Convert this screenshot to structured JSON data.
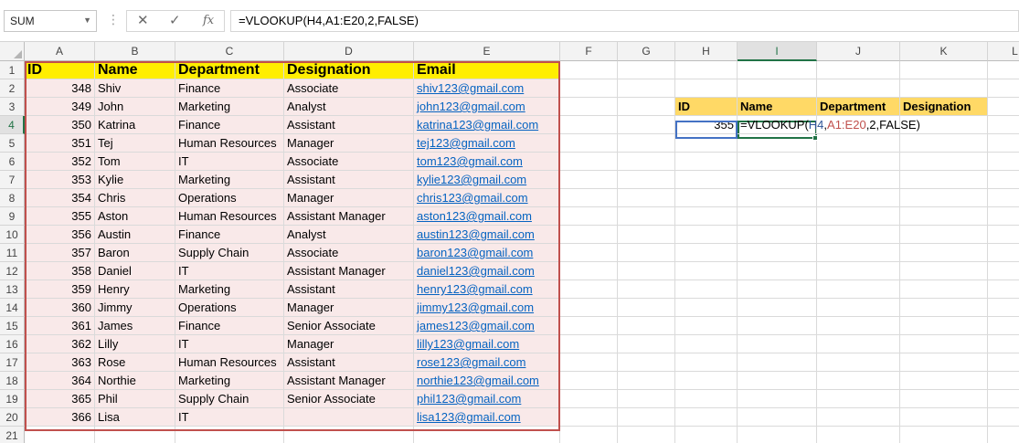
{
  "formula_bar": {
    "name_box": "SUM",
    "cancel_icon": "✕",
    "enter_icon": "✓",
    "fx_label": "fx",
    "formula": "=VLOOKUP(H4,A1:E20,2,FALSE)"
  },
  "columns": [
    "A",
    "B",
    "C",
    "D",
    "E",
    "F",
    "G",
    "H",
    "I",
    "J",
    "K",
    "L"
  ],
  "rows": [
    "1",
    "2",
    "3",
    "4",
    "5",
    "6",
    "7",
    "8",
    "9",
    "10",
    "11",
    "12",
    "13",
    "14",
    "15",
    "16",
    "17",
    "18",
    "19",
    "20",
    "21"
  ],
  "table": {
    "headers": [
      "ID",
      "Name",
      "Department",
      "Designation",
      "Email"
    ],
    "records": [
      [
        "348",
        "Shiv",
        "Finance",
        "Associate",
        "shiv123@gmail.com"
      ],
      [
        "349",
        "John",
        "Marketing",
        "Analyst",
        "john123@gmail.com"
      ],
      [
        "350",
        "Katrina",
        "Finance",
        "Assistant",
        "katrina123@gmail.com"
      ],
      [
        "351",
        "Tej",
        "Human Resources",
        "Manager",
        "tej123@gmail.com"
      ],
      [
        "352",
        "Tom",
        "IT",
        "Associate",
        "tom123@gmail.com"
      ],
      [
        "353",
        "Kylie",
        "Marketing",
        "Assistant",
        "kylie123@gmail.com"
      ],
      [
        "354",
        "Chris",
        "Operations",
        "Manager",
        "chris123@gmail.com"
      ],
      [
        "355",
        "Aston",
        "Human Resources",
        "Assistant Manager",
        "aston123@gmail.com"
      ],
      [
        "356",
        "Austin",
        "Finance",
        "Analyst",
        "austin123@gmail.com"
      ],
      [
        "357",
        "Baron",
        "Supply Chain",
        "Associate",
        "baron123@gmail.com"
      ],
      [
        "358",
        "Daniel",
        "IT",
        "Assistant Manager",
        "daniel123@gmail.com"
      ],
      [
        "359",
        "Henry",
        "Marketing",
        "Assistant",
        "henry123@gmail.com"
      ],
      [
        "360",
        "Jimmy",
        "Operations",
        "Manager",
        "jimmy123@gmail.com"
      ],
      [
        "361",
        "James",
        "Finance",
        "Senior Associate",
        "james123@gmail.com"
      ],
      [
        "362",
        "Lilly",
        "IT",
        "Manager",
        "lilly123@gmail.com"
      ],
      [
        "363",
        "Rose",
        "Human Resources",
        "Assistant",
        "rose123@gmail.com"
      ],
      [
        "364",
        "Northie",
        "Marketing",
        "Assistant Manager",
        "northie123@gmail.com"
      ],
      [
        "365",
        "Phil",
        "Supply Chain",
        "Senior Associate",
        "phil123@gmail.com"
      ],
      [
        "366",
        "Lisa",
        "IT",
        "",
        "lisa123@gmail.com"
      ]
    ]
  },
  "lookup": {
    "headers": [
      "ID",
      "Name",
      "Department",
      "Designation"
    ],
    "id_value": "355",
    "formula_parts": {
      "prefix": "=VLOOKUP(",
      "ref_h": "H4",
      "sep1": ",",
      "ref_range": "A1:E20",
      "suffix": ",2,FALSE)"
    }
  },
  "colors": {
    "header_yellow": "#ffee00",
    "data_pink": "#f9e9e9",
    "lookup_header": "#ffd966",
    "range_border": "#c0504d",
    "active_green": "#217346",
    "ref_blue": "#4472c4"
  }
}
